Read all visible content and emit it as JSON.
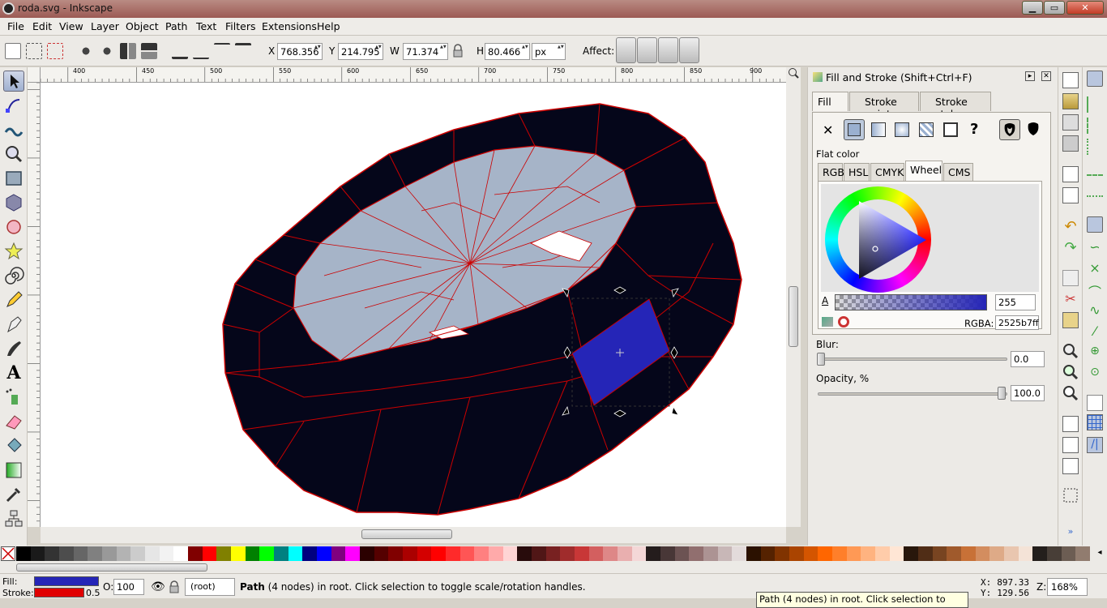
{
  "window": {
    "title": "roda.svg - Inkscape",
    "minimize": "▁",
    "maximize": "▭",
    "close": "✕"
  },
  "menu": [
    "File",
    "Edit",
    "View",
    "Layer",
    "Object",
    "Path",
    "Text",
    "Filters",
    "Extensions",
    "Help"
  ],
  "toolctl": {
    "x_label": "X",
    "x_value": "768.356",
    "y_label": "Y",
    "y_value": "214.795",
    "w_label": "W",
    "w_value": "71.374",
    "h_label": "H",
    "h_value": "80.466",
    "unit": "px",
    "affect_label": "Affect:"
  },
  "ruler": {
    "h_ticks": [
      "400",
      "450",
      "500",
      "550",
      "600",
      "650",
      "700",
      "750",
      "800",
      "850",
      "900"
    ],
    "v_ticks": [
      "450",
      "400",
      "350",
      "300",
      "250",
      "200",
      "150",
      "100",
      "50"
    ]
  },
  "dock": {
    "title": "Fill and Stroke (Shift+Ctrl+F)",
    "tabs": [
      "Fill",
      "Stroke paint",
      "Stroke style"
    ],
    "flat_color_label": "Flat color",
    "color_tabs": [
      "RGB",
      "HSL",
      "CMYK",
      "Wheel",
      "CMS"
    ],
    "alpha_label": "A",
    "alpha_value": "255",
    "rgba_label": "RGBA:",
    "rgba_value": "2525b7ff",
    "blur_label": "Blur:",
    "blur_value": "0.0",
    "opacity_label": "Opacity, %",
    "opacity_value": "100.0",
    "fill_unset_glyph": "✕",
    "fill_unknown_glyph": "?"
  },
  "status": {
    "fill_label": "Fill:",
    "stroke_label": "Stroke:",
    "stroke_width": "0.5",
    "fill_color": "#2525b7",
    "stroke_color": "#e00000",
    "opacity_label": "O:",
    "opacity_value": "100",
    "layer": "(root)",
    "message_bold": "Path",
    "message": " (4 nodes) in root. Click selection to toggle scale/rotation handles.",
    "tooltip": "Path (4 nodes) in root. Click selection to",
    "x_label": "X:",
    "x_value": "897.33",
    "y_label": "Y:",
    "y_value": "129.56",
    "zoom_label": "Z:",
    "zoom_value": "168%"
  },
  "colors": {
    "tire": "#05061a",
    "rim": "#a6b4c8",
    "edge": "#cc0000",
    "selected": "#2525b7"
  },
  "palette": [
    "#000000",
    "#1a1a1a",
    "#333333",
    "#4d4d4d",
    "#666666",
    "#808080",
    "#999999",
    "#b3b3b3",
    "#cccccc",
    "#e6e6e6",
    "#f2f2f2",
    "#ffffff",
    "#800000",
    "#ff0000",
    "#808000",
    "#ffff00",
    "#008000",
    "#00ff00",
    "#008080",
    "#00ffff",
    "#000080",
    "#0000ff",
    "#800080",
    "#ff00ff",
    "#2b0000",
    "#550000",
    "#800000",
    "#aa0000",
    "#d40000",
    "#ff0000",
    "#ff2a2a",
    "#ff5555",
    "#ff8080",
    "#ffaaaa",
    "#ffd5d5",
    "#280b0b",
    "#501616",
    "#782121",
    "#a02c2c",
    "#c83737",
    "#d35f5f",
    "#de8787",
    "#e9afaf",
    "#f4d7d7",
    "#241c1c",
    "#483737",
    "#6c5353",
    "#916f6f",
    "#ac9393",
    "#c8b7b7",
    "#e3dbdb",
    "#2b1100",
    "#552200",
    "#803300",
    "#aa4400",
    "#d45500",
    "#ff6600",
    "#ff7f2a",
    "#ff9955",
    "#ffb380",
    "#ffccaa",
    "#ffe6d5",
    "#28170b",
    "#502d16",
    "#784421",
    "#a05a2c",
    "#c87137",
    "#d38d5f",
    "#deaa87",
    "#e9c6af",
    "#f4e3d7",
    "#241f1c",
    "#483e37",
    "#6c5d53",
    "#917c6f"
  ]
}
